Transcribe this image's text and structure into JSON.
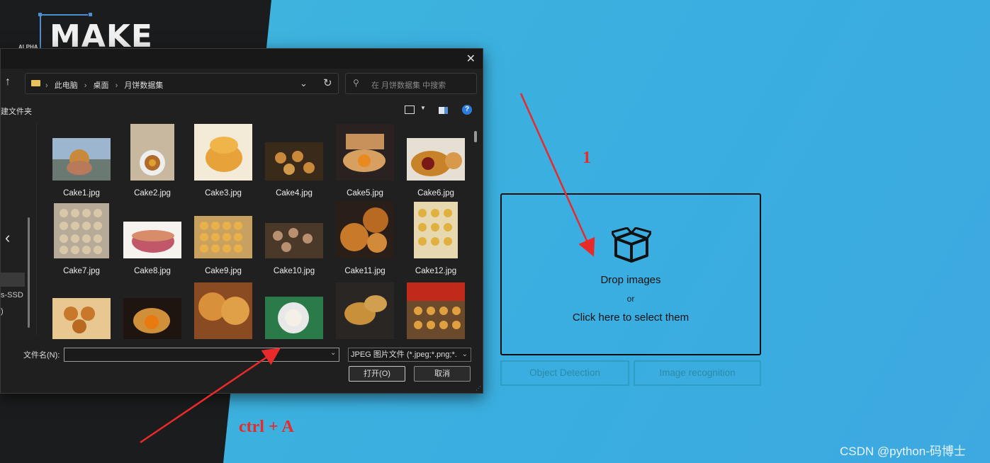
{
  "app": {
    "logo": "MAKE",
    "logo_sub": "ALPHA"
  },
  "dialog": {
    "close": "✕",
    "breadcrumbs": [
      "此电脑",
      "桌面",
      "月饼数据集"
    ],
    "search_placeholder": "在 月饼数据集 中搜索",
    "new_folder": "建文件夹",
    "nav_items": {
      "ssd": "s-SSD",
      "paren": ")"
    },
    "files": [
      {
        "name": "Cake1.jpg"
      },
      {
        "name": "Cake2.jpg"
      },
      {
        "name": "Cake3.jpg"
      },
      {
        "name": "Cake4.jpg"
      },
      {
        "name": "Cake5.jpg"
      },
      {
        "name": "Cake6.jpg"
      },
      {
        "name": "Cake7.jpg"
      },
      {
        "name": "Cake8.jpg"
      },
      {
        "name": "Cake9.jpg"
      },
      {
        "name": "Cake10.jpg"
      },
      {
        "name": "Cake11.jpg"
      },
      {
        "name": "Cake12.jpg"
      },
      {
        "name": ""
      },
      {
        "name": ""
      },
      {
        "name": ""
      },
      {
        "name": ""
      },
      {
        "name": ""
      },
      {
        "name": ""
      }
    ],
    "filename_label": "文件名(N):",
    "filename_value": "",
    "filetype": "JPEG 图片文件 (*.jpeg;*.png;*.",
    "open_button": "打开(O)",
    "cancel_button": "取消"
  },
  "drop_zone": {
    "title": "Drop images",
    "or": "or",
    "click": "Click here to select them"
  },
  "tabs": {
    "object_detection": "Object Detection",
    "image_recognition": "Image recognition"
  },
  "annotations": {
    "step1": "1",
    "shortcut": "ctrl + A"
  },
  "watermark": "CSDN @python-码博士"
}
